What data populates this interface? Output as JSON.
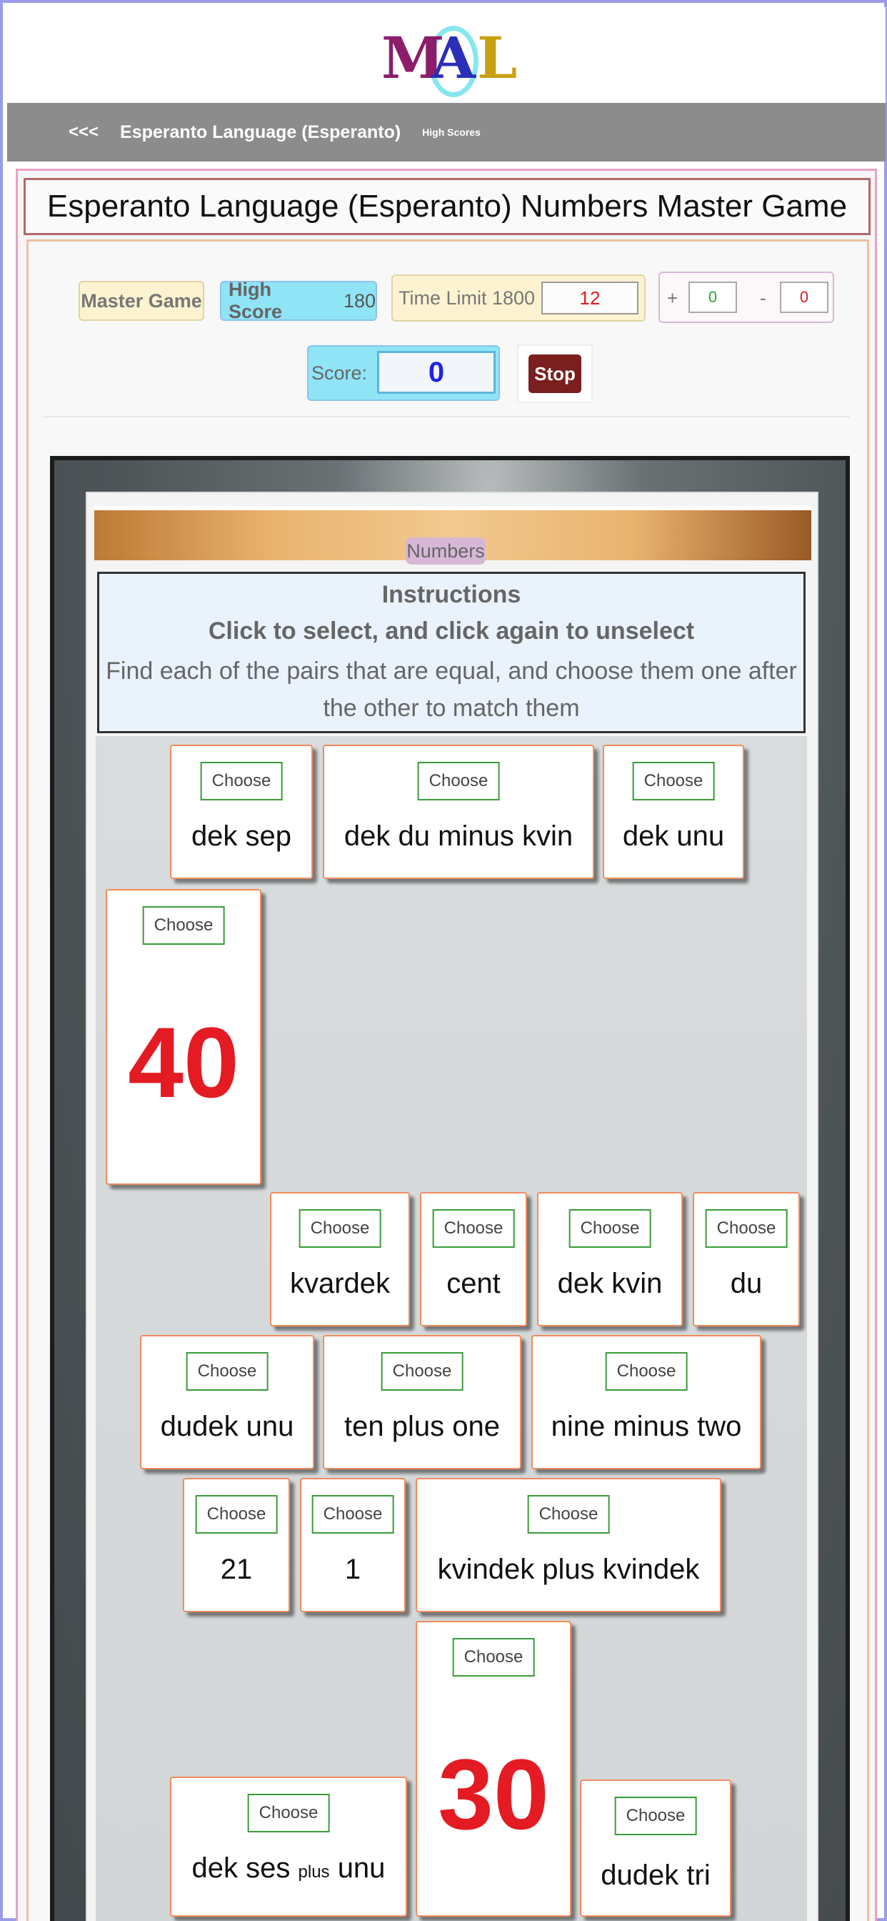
{
  "logo": {
    "letters": [
      "M",
      "A",
      "L"
    ]
  },
  "nav": {
    "back": "<<<",
    "title": "Esperanto Language (Esperanto)",
    "high_scores": "High Scores"
  },
  "page_title": "Esperanto Language (Esperanto) Numbers Master Game",
  "status": {
    "master_game": "Master Game",
    "high_score_label": "High Score",
    "high_score_value": "180",
    "time_limit_label": "Time Limit 1800",
    "time_value": "12",
    "plus": "+",
    "plus_value": "0",
    "minus": "-",
    "minus_value": "0",
    "score_label": "Score:",
    "score_value": "0",
    "stop": "Stop"
  },
  "board": {
    "category": "Numbers",
    "instructions_title": "Instructions",
    "instructions_sub": "Click to select, and click again to unselect",
    "instructions_body": "Find each of the pairs that are equal, and choose them one after the other to match them",
    "choose_label": "Choose",
    "cards": [
      {
        "text": "dek sep"
      },
      {
        "text": "dek du minus kvin"
      },
      {
        "text": "dek unu"
      },
      {
        "text": "40",
        "big": true
      },
      {
        "text": "kvardek"
      },
      {
        "text": "cent"
      },
      {
        "text": "dek kvin"
      },
      {
        "text": "du"
      },
      {
        "text": "dudek unu"
      },
      {
        "text": "ten plus one"
      },
      {
        "text": "nine minus two"
      },
      {
        "text": "21"
      },
      {
        "text": "1"
      },
      {
        "text": "kvindek plus kvindek"
      },
      {
        "text": "30",
        "big": true
      },
      {
        "text_a": "dek ses",
        "text_small": "plus",
        "text_b": "unu"
      },
      {
        "text": "dudek tri"
      },
      {
        "text": ""
      }
    ]
  },
  "colors": {
    "accent_red": "#e41b23",
    "score_blue": "#1e22e8",
    "stop_bg": "#7b1e1e",
    "choose_border": "#3a9a3a",
    "card_border": "#f08c5c"
  }
}
